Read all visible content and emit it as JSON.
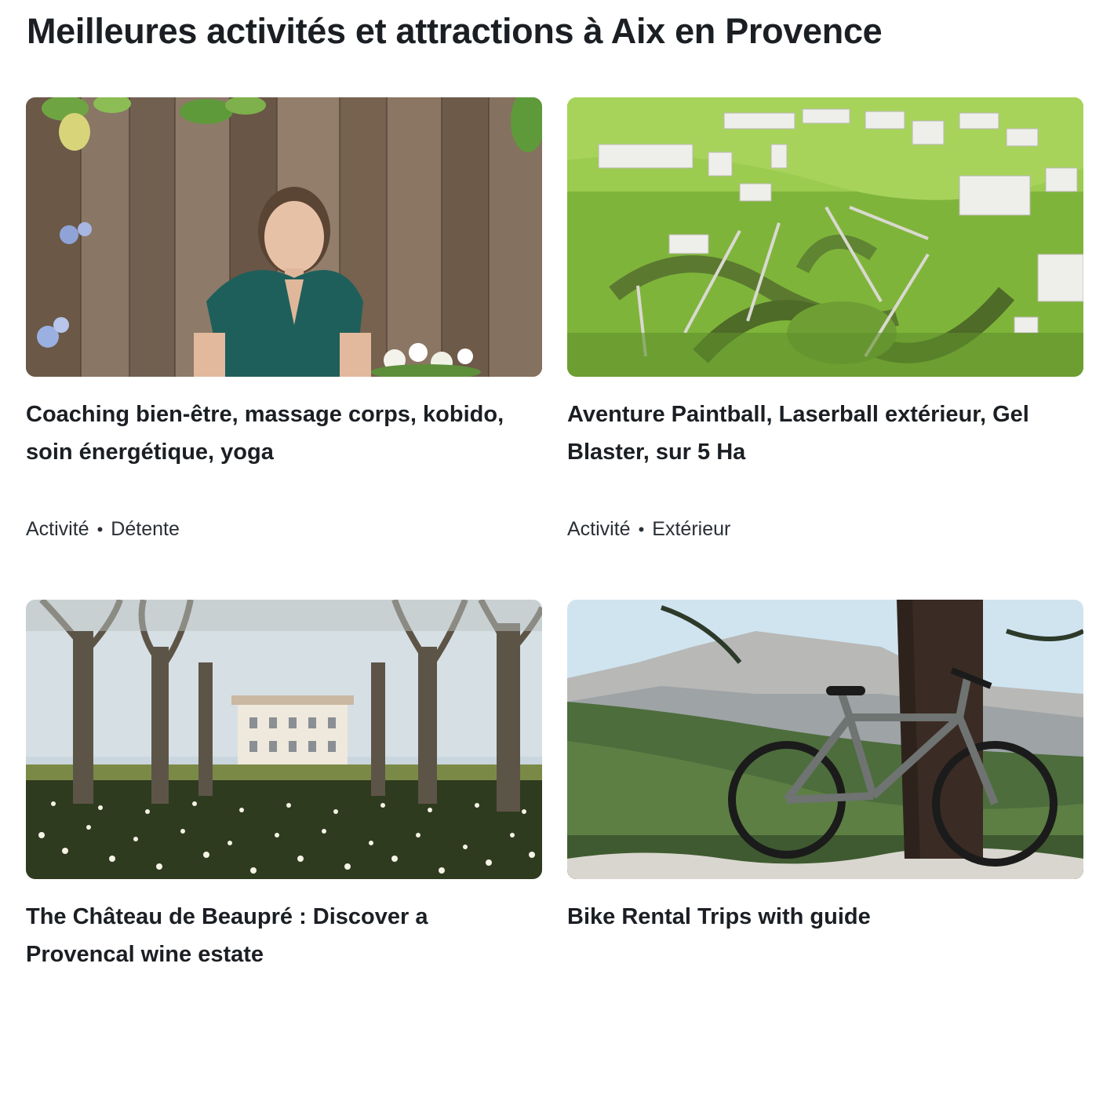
{
  "page": {
    "title": "Meilleures activités et attractions à Aix en Provence"
  },
  "cards": [
    {
      "title": "Coaching bien-être, massage corps, kobido, soin énergétique, yoga",
      "meta": [
        "Activité",
        "Détente"
      ],
      "image_subject": "woman-smiling-wooden-fence"
    },
    {
      "title": "Aventure Paintball, Laserball extérieur, Gel Blaster, sur 5 Ha",
      "meta": [
        "Activité",
        "Extérieur"
      ],
      "image_subject": "paintball-field-aerial"
    },
    {
      "title": "The Château de Beaupré : Discover a Provencal wine estate",
      "meta": [],
      "image_subject": "chateau-plane-trees-daffodils"
    },
    {
      "title": "Bike Rental Trips with guide",
      "meta": [],
      "image_subject": "bike-against-tree-mountain"
    }
  ],
  "colors": {
    "text": "#1b1f23",
    "meta_text": "#2a2f35",
    "background": "#ffffff"
  }
}
